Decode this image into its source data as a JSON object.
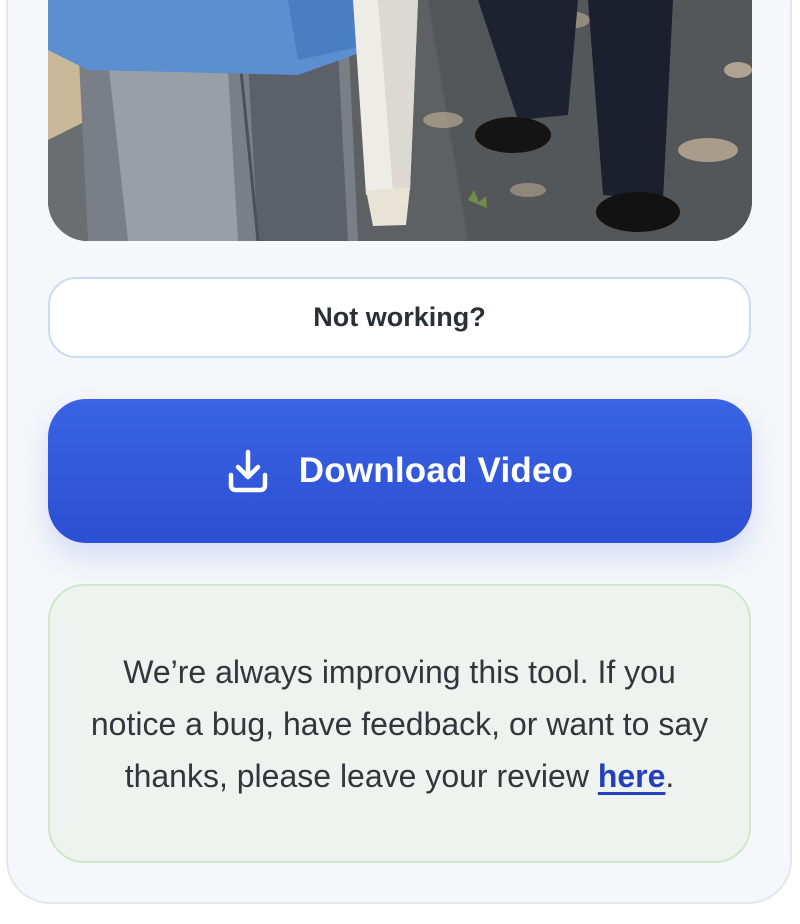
{
  "actions": {
    "not_working_label": "Not working?",
    "download_label": "Download Video",
    "download_icon": "download-icon"
  },
  "feedback": {
    "text_before_link": "We’re always improving this tool. If you notice a bug, have feedback, or want to say thanks, please leave your review ",
    "link_label": "here",
    "text_after_link": "."
  },
  "colors": {
    "primary_button": "#2f55d9",
    "feedback_background": "#eef3ef",
    "feedback_border": "#cfe6cc",
    "link": "#2340b8"
  }
}
